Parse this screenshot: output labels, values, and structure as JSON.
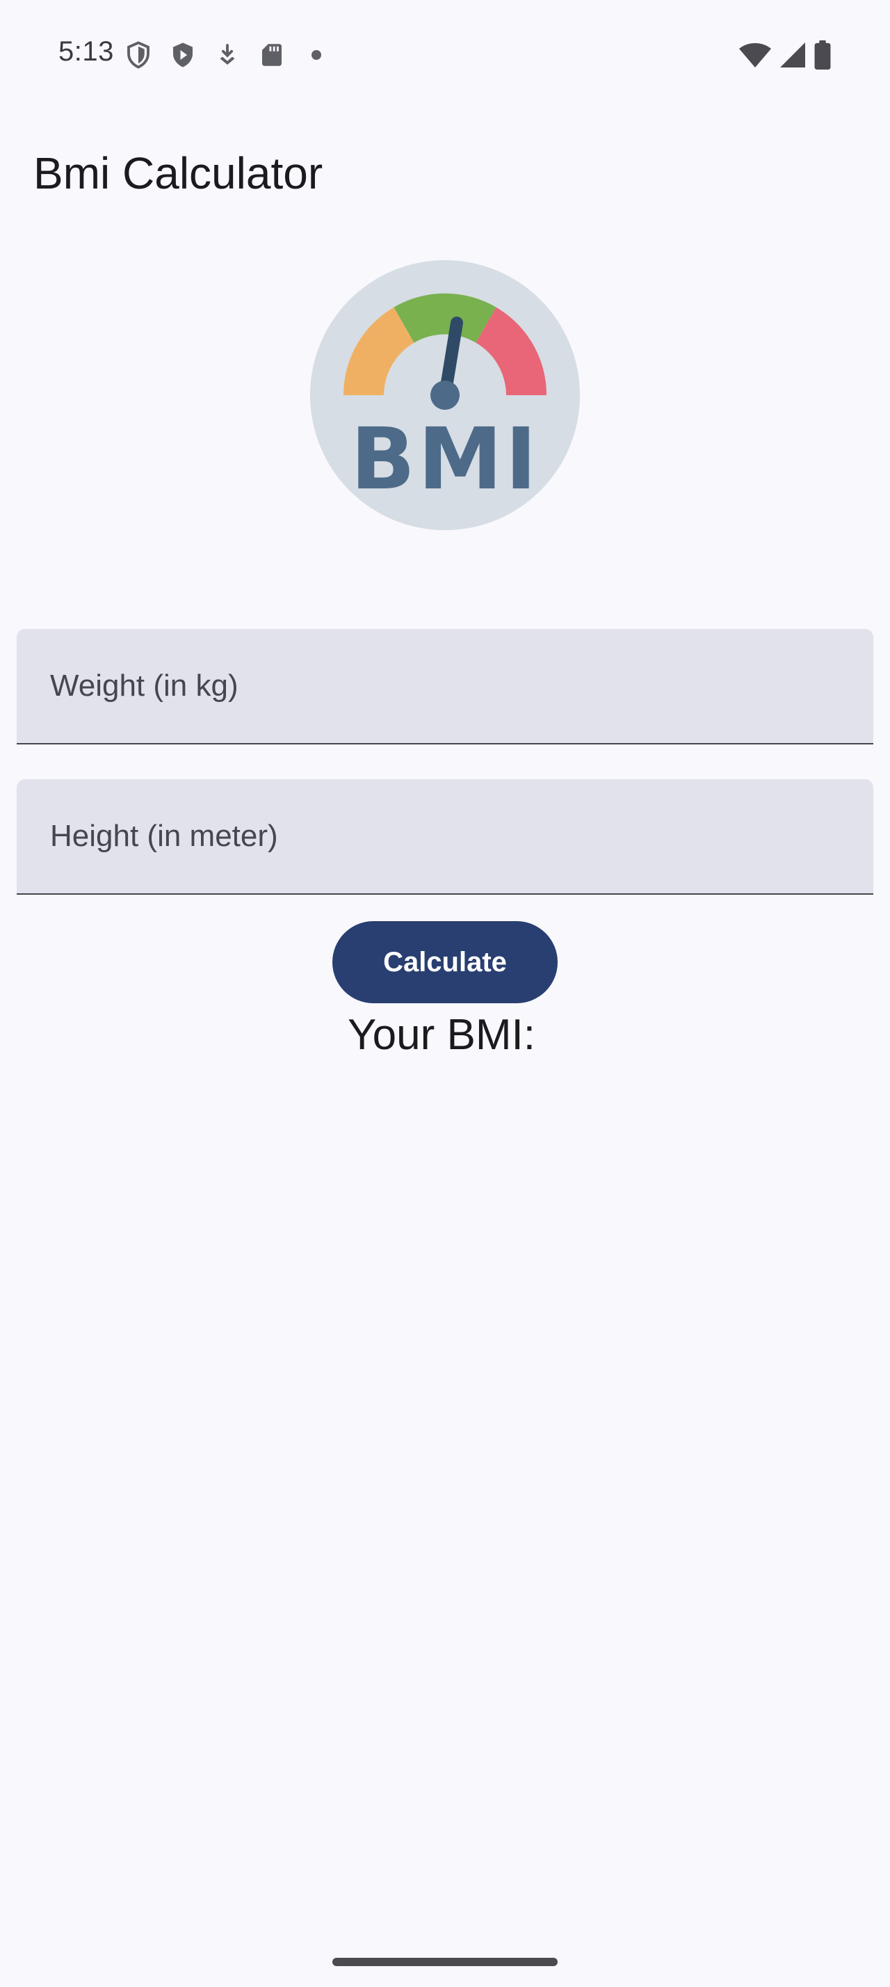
{
  "status_bar": {
    "time": "5:13",
    "left_icons": [
      "shield-outline-icon",
      "shield-play-icon",
      "download-icon",
      "sd-card-icon",
      "dot-icon"
    ],
    "right_icons": [
      "wifi-icon",
      "cell-signal-icon",
      "battery-icon"
    ]
  },
  "app_bar": {
    "title": "Bmi Calculator"
  },
  "logo": {
    "text": "BMI",
    "colors": {
      "background": "#d6dde4",
      "left_arc": "#f0b063",
      "middle_arc": "#79b14f",
      "right_arc": "#e86677",
      "needle": "#2e4a66",
      "letters": "#4e6a89"
    }
  },
  "form": {
    "weight": {
      "placeholder": "Weight (in kg)",
      "value": ""
    },
    "height": {
      "placeholder": "Height (in meter)",
      "value": ""
    },
    "calculate_label": "Calculate"
  },
  "result": {
    "label": "Your BMI:"
  },
  "theme": {
    "background": "#f8f8fd",
    "field_fill": "#e1e2ec",
    "button": "#293f71"
  }
}
